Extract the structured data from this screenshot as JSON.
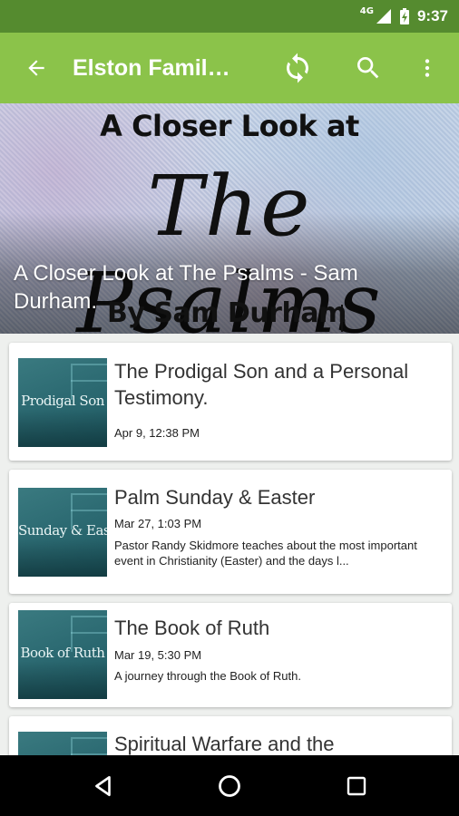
{
  "status_bar": {
    "network": "4G",
    "time": "9:37"
  },
  "app_bar": {
    "title": "Elston Famil…"
  },
  "hero": {
    "title_small": "A Closer Look at",
    "title_large": "The Psalms",
    "author_line": "By Sam Durham",
    "caption": "A Closer Look at The Psalms - Sam Durham."
  },
  "items": [
    {
      "thumb_label": "Prodigal Son",
      "title": "The Prodigal Son and a Personal Testimony.",
      "date": "Apr 9, 12:38 PM",
      "description": ""
    },
    {
      "thumb_label": "Sunday & Easter",
      "title": "Palm Sunday & Easter",
      "date": "Mar 27, 1:03 PM",
      "description": "Pastor Randy Skidmore teaches about the most important event in Christianity (Easter) and the days l..."
    },
    {
      "thumb_label": "Book of Ruth",
      "title": "The Book of Ruth",
      "date": "Mar 19, 5:30 PM",
      "description": "A journey through the Book of  Ruth."
    },
    {
      "thumb_label": "",
      "title": "Spiritual Warfare and the",
      "date": "",
      "description": ""
    }
  ],
  "colors": {
    "status_bar": "#558b2f",
    "app_bar": "#8bc34a",
    "thumb": "#2c6a72"
  },
  "icons": {
    "back": "arrow-left-icon",
    "refresh": "refresh-icon",
    "search": "search-icon",
    "more": "more-vert-icon"
  }
}
